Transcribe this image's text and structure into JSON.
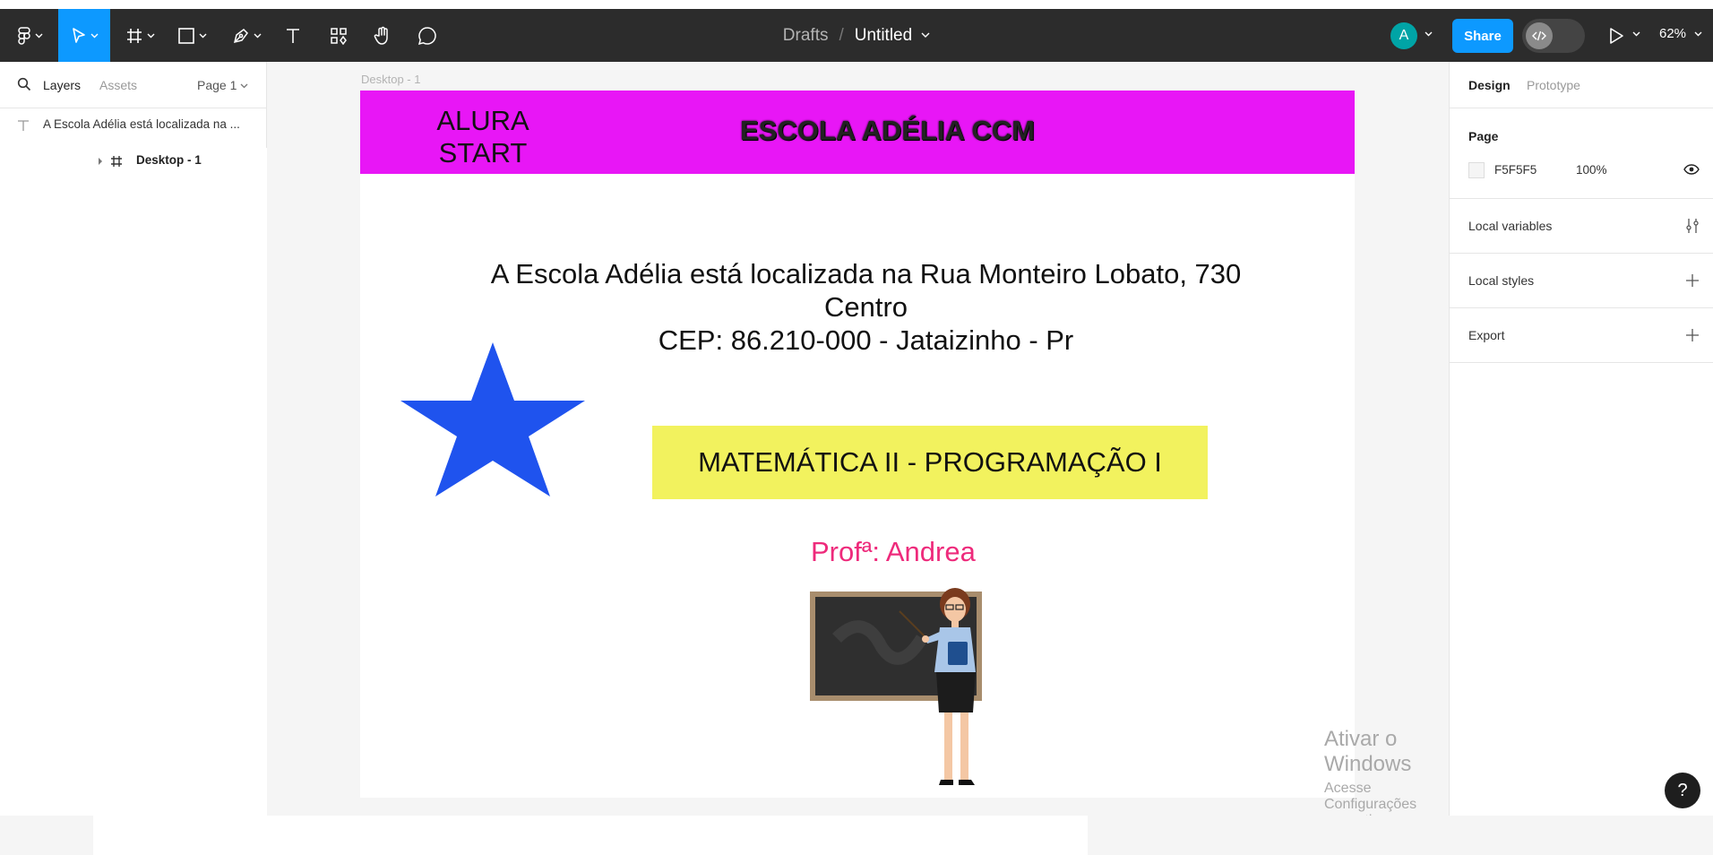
{
  "toolbar": {
    "breadcrumb_parent": "Drafts",
    "breadcrumb_separator": "/",
    "file_title": "Untitled",
    "avatar_initial": "A",
    "share_label": "Share",
    "zoom_level": "62%",
    "accent_color": "#0d99ff"
  },
  "left_panel": {
    "tabs": [
      "Layers",
      "Assets"
    ],
    "page_selector": "Page 1",
    "layers": [
      {
        "type": "text",
        "label": "A Escola Adélia está localizada na ..."
      },
      {
        "type": "frame",
        "label": "Desktop - 1"
      }
    ]
  },
  "canvas": {
    "frame_label": "Desktop - 1",
    "banner": {
      "color": "#e816f6",
      "left_text_line1": "ALURA",
      "left_text_line2": "START",
      "title": "ESCOLA ADÉLIA CCM"
    },
    "address_lines": [
      "A Escola Adélia está localizada na Rua Monteiro Lobato, 730",
      "Centro",
      "CEP: 86.210-000 - Jataizinho - Pr"
    ],
    "star_color": "#1f53ee",
    "subject": {
      "text": "MATEMÁTICA II - PROGRAMAÇÃO I",
      "color": "#f2f25e"
    },
    "teacher_name": "Profª: Andrea",
    "teacher_name_color": "#ee2a7b",
    "watermark": {
      "line1": "Ativar o Windows",
      "line2": "Acesse Configurações para ativar o Windows."
    }
  },
  "right_panel": {
    "tabs": [
      "Design",
      "Prototype"
    ],
    "page_section_title": "Page",
    "page_color_hex": "F5F5F5",
    "page_opacity": "100%",
    "sections": [
      "Local variables",
      "Local styles",
      "Export"
    ]
  },
  "help_label": "?"
}
